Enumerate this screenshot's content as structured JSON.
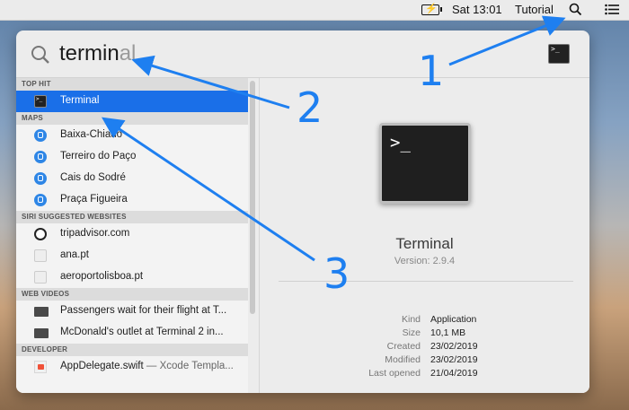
{
  "menubar": {
    "clock": "Sat 13:01",
    "user": "Tutorial",
    "icons": [
      "battery-charging-icon",
      "spotlight-search-icon",
      "notification-center-icon"
    ]
  },
  "spotlight": {
    "query_typed": "termin",
    "query_completion": "al",
    "sections": [
      {
        "header": "TOP HIT",
        "items": [
          {
            "label": "Terminal",
            "icon": "terminal-icon",
            "selected": true
          }
        ]
      },
      {
        "header": "MAPS",
        "items": [
          {
            "label": "Baixa-Chiado",
            "icon": "transit-icon"
          },
          {
            "label": "Terreiro do Paço",
            "icon": "transit-icon"
          },
          {
            "label": "Cais do Sodré",
            "icon": "transit-icon"
          },
          {
            "label": "Praça Figueira",
            "icon": "transit-icon"
          }
        ]
      },
      {
        "header": "SIRI SUGGESTED WEBSITES",
        "items": [
          {
            "label": "tripadvisor.com",
            "icon": "tripadvisor-icon"
          },
          {
            "label": "ana.pt",
            "icon": "website-icon"
          },
          {
            "label": "aeroportolisboa.pt",
            "icon": "website-icon"
          }
        ]
      },
      {
        "header": "WEB VIDEOS",
        "items": [
          {
            "label": "Passengers wait for their flight at T...",
            "icon": "video-thumbnail-icon"
          },
          {
            "label": "McDonald's outlet at Terminal 2 in...",
            "icon": "video-thumbnail-icon"
          }
        ]
      },
      {
        "header": "DEVELOPER",
        "items": [
          {
            "label": "AppDelegate.swift",
            "sub": "— Xcode Templa...",
            "icon": "swift-file-icon"
          }
        ]
      }
    ],
    "preview": {
      "name": "Terminal",
      "version": "Version: 2.9.4",
      "meta": [
        {
          "key": "Kind",
          "value": "Application"
        },
        {
          "key": "Size",
          "value": "10,1 MB"
        },
        {
          "key": "Created",
          "value": "23/02/2019"
        },
        {
          "key": "Modified",
          "value": "23/02/2019"
        },
        {
          "key": "Last opened",
          "value": "21/04/2019"
        }
      ]
    }
  },
  "annotations": {
    "labels": [
      "1",
      "2",
      "3"
    ],
    "arrow_color": "#1e7ff0"
  },
  "colors": {
    "selection": "#1a6fe8"
  }
}
